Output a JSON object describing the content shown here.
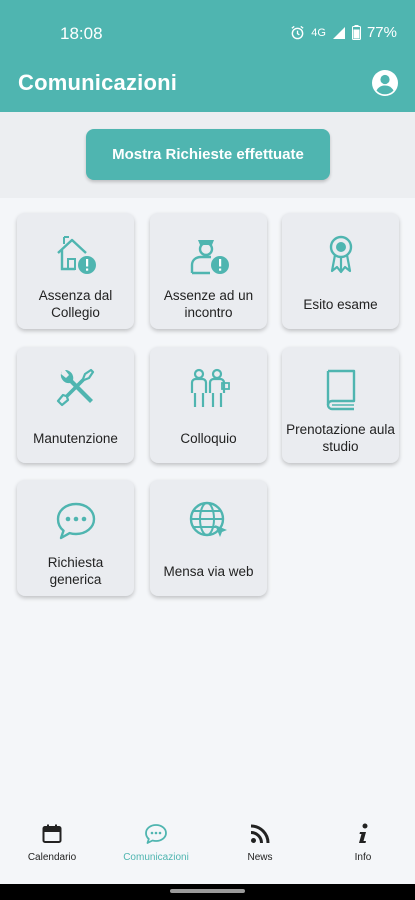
{
  "status_bar": {
    "time": "18:08",
    "network": "4G",
    "battery": "77%"
  },
  "header": {
    "title": "Comunicazioni"
  },
  "actions": {
    "show_requests_label": "Mostra Richieste effettuate"
  },
  "tiles": [
    {
      "label": "Assenza dal Collegio",
      "icon": "house-alert-icon"
    },
    {
      "label": "Assenze ad un incontro",
      "icon": "person-alert-icon"
    },
    {
      "label": "Esito esame",
      "icon": "award-ribbon-icon"
    },
    {
      "label": "Manutenzione",
      "icon": "wrench-screwdriver-icon"
    },
    {
      "label": "Colloquio",
      "icon": "meeting-people-icon"
    },
    {
      "label": "Prenotazione aula studio",
      "icon": "book-icon"
    },
    {
      "label": "Richiesta generica",
      "icon": "chat-bubble-icon"
    },
    {
      "label": "Mensa via web",
      "icon": "globe-cursor-icon"
    }
  ],
  "bottom_nav": [
    {
      "label": "Calendario",
      "icon": "calendar-icon",
      "active": false
    },
    {
      "label": "Comunicazioni",
      "icon": "chat-icon",
      "active": true
    },
    {
      "label": "News",
      "icon": "rss-icon",
      "active": false
    },
    {
      "label": "Info",
      "icon": "info-icon",
      "active": false
    }
  ],
  "colors": {
    "accent": "#4fb5b0",
    "background": "#f4f6f9",
    "tile": "#eaecf0"
  }
}
